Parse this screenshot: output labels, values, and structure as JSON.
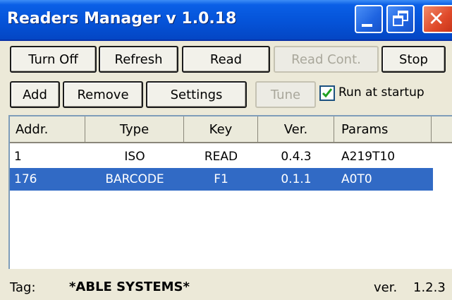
{
  "window": {
    "title": "Readers Manager v 1.0.18"
  },
  "toolbar1": {
    "turn_off": "Turn Off",
    "refresh": "Refresh",
    "read": "Read",
    "read_cont": "Read Cont.",
    "stop": "Stop"
  },
  "toolbar2": {
    "add": "Add",
    "remove": "Remove",
    "settings": "Settings",
    "tune": "Tune",
    "run_at_startup": "Run at startup",
    "run_at_startup_checked": true
  },
  "table": {
    "columns": [
      "Addr.",
      "Type",
      "Key",
      "Ver.",
      "Params"
    ],
    "rows": [
      {
        "addr": "1",
        "type": "ISO",
        "key": "READ",
        "ver": "0.4.3",
        "params": "A219T10",
        "selected": false
      },
      {
        "addr": "176",
        "type": "BARCODE",
        "key": "F1",
        "ver": "0.1.1",
        "params": "A0T0",
        "selected": true
      }
    ]
  },
  "status": {
    "tag_label": "Tag:",
    "tag_value": "*ABLE SYSTEMS*",
    "ver_label": "ver.",
    "ver_value": "1.2.3"
  },
  "colors": {
    "title_bar": "#0553d8",
    "selection": "#316ac5",
    "close_button": "#e04a2a"
  }
}
